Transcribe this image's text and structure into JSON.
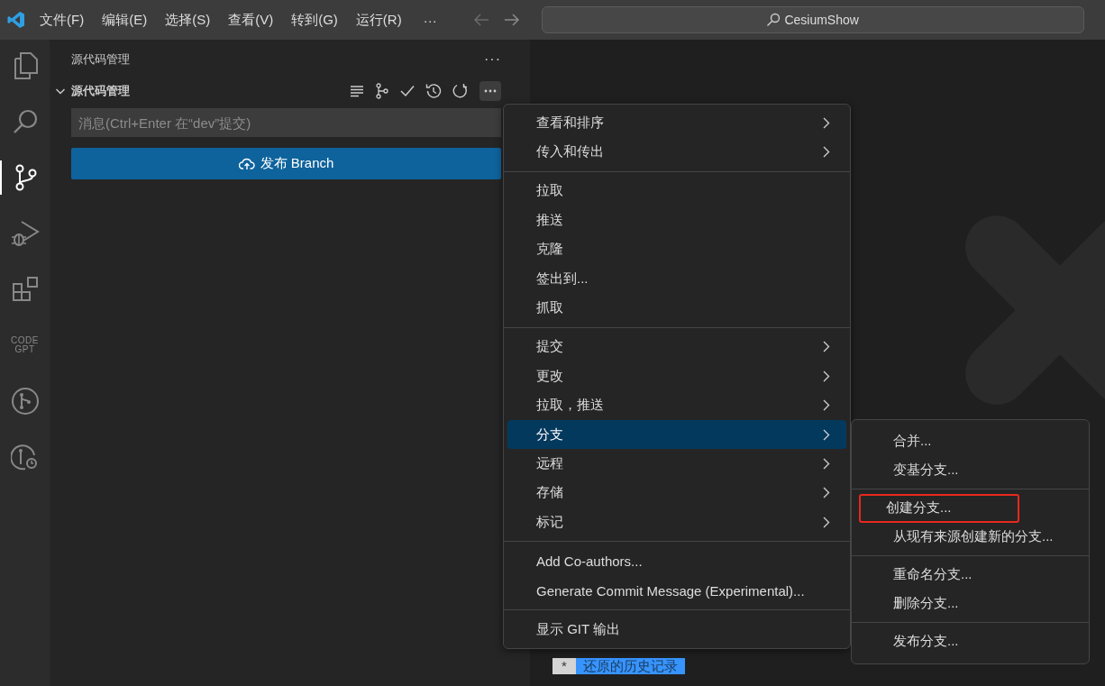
{
  "title_bar": {
    "menus": [
      "文件(F)",
      "编辑(E)",
      "选择(S)",
      "查看(V)",
      "转到(G)",
      "运行(R)"
    ],
    "more": "···",
    "search": "CesiumShow"
  },
  "activity_bar": {
    "items": [
      {
        "kind": "files",
        "selected": false
      },
      {
        "kind": "search",
        "selected": false
      },
      {
        "kind": "source-control",
        "selected": true
      },
      {
        "kind": "run-debug",
        "selected": false
      },
      {
        "kind": "extensions",
        "selected": false
      },
      {
        "kind": "text-logo",
        "lines": [
          "CODE",
          "GPT"
        ],
        "selected": false
      },
      {
        "kind": "git-graph",
        "selected": false
      },
      {
        "kind": "git-history",
        "selected": false
      }
    ]
  },
  "sidebar": {
    "title": "源代码管理",
    "more": "···",
    "section": {
      "title": "源代码管理",
      "expanded": true,
      "more_selected": true
    },
    "commit_message": {
      "placeholder": "消息(Ctrl+Enter 在“dev”提交)"
    },
    "publish_button": "发布 Branch"
  },
  "editor": {
    "tab_marker": "*",
    "tab_label": "还原的历史记录"
  },
  "context_menu": {
    "groups": [
      [
        {
          "label": "查看和排序",
          "has_submenu": true,
          "selected": false
        },
        {
          "label": "传入和传出",
          "has_submenu": true,
          "selected": false
        }
      ],
      [
        {
          "label": "拉取",
          "has_submenu": false,
          "selected": false
        },
        {
          "label": "推送",
          "has_submenu": false,
          "selected": false
        },
        {
          "label": "克隆",
          "has_submenu": false,
          "selected": false
        },
        {
          "label": "签出到...",
          "has_submenu": false,
          "selected": false
        },
        {
          "label": "抓取",
          "has_submenu": false,
          "selected": false
        }
      ],
      [
        {
          "label": "提交",
          "has_submenu": true,
          "selected": false
        },
        {
          "label": "更改",
          "has_submenu": true,
          "selected": false
        },
        {
          "label": "拉取，推送",
          "has_submenu": true,
          "selected": false
        },
        {
          "label": "分支",
          "has_submenu": true,
          "selected": true
        },
        {
          "label": "远程",
          "has_submenu": true,
          "selected": false
        },
        {
          "label": "存储",
          "has_submenu": true,
          "selected": false
        },
        {
          "label": "标记",
          "has_submenu": true,
          "selected": false
        }
      ],
      [
        {
          "label": "Add Co-authors...",
          "has_submenu": false,
          "selected": false
        },
        {
          "label": "Generate Commit Message (Experimental)...",
          "has_submenu": false,
          "selected": false
        }
      ],
      [
        {
          "label": "显示 GIT 输出",
          "has_submenu": false,
          "selected": false
        }
      ]
    ]
  },
  "submenu": {
    "groups": [
      [
        {
          "label": "合并...",
          "highlighted": false
        },
        {
          "label": "变基分支...",
          "highlighted": false
        }
      ],
      [
        {
          "label": "创建分支...",
          "highlighted": true
        },
        {
          "label": "从现有来源创建新的分支...",
          "highlighted": false
        }
      ],
      [
        {
          "label": "重命名分支...",
          "highlighted": false
        },
        {
          "label": "删除分支...",
          "highlighted": false
        }
      ],
      [
        {
          "label": "发布分支...",
          "highlighted": false
        }
      ]
    ]
  }
}
